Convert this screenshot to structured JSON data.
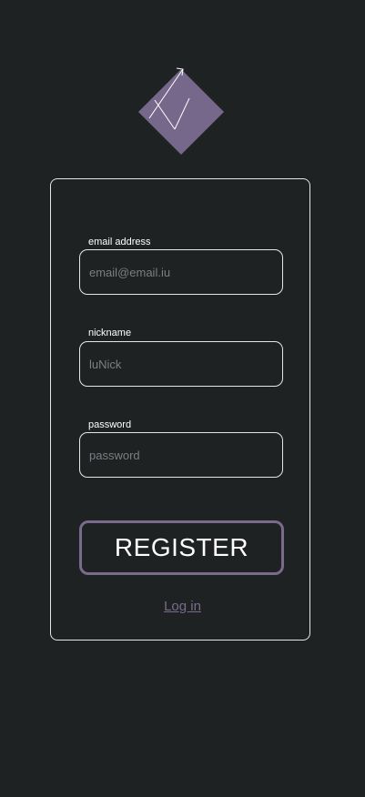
{
  "logo": {
    "icon": "diamond-check-logo",
    "color": "#76688a"
  },
  "form": {
    "email": {
      "label": "email address",
      "placeholder": "email@email.iu",
      "value": ""
    },
    "nickname": {
      "label": "nickname",
      "placeholder": "luNick",
      "value": ""
    },
    "password": {
      "label": "password",
      "placeholder": "password",
      "value": ""
    },
    "register_label": "REGISTER",
    "login_label": "Log in"
  },
  "colors": {
    "background": "#1f2223",
    "accent": "#7a6a8c",
    "border": "#e6e6e6",
    "placeholder": "#7b7f82"
  }
}
